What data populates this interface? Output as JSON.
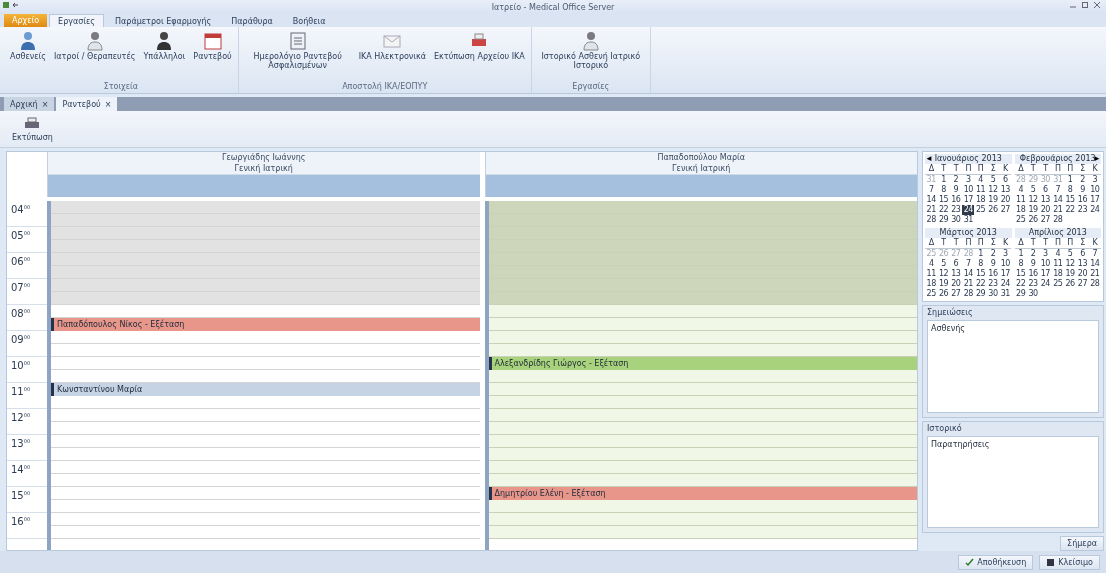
{
  "window": {
    "title": "Ιατρείο - Medical Office Server"
  },
  "ribbon": {
    "app_button": "Αρχείο",
    "tabs": [
      {
        "label": "Εργασίες",
        "selected": true
      },
      {
        "label": "Παράμετροι Εφαρμογής",
        "selected": false
      },
      {
        "label": "Παράθυρα",
        "selected": false
      },
      {
        "label": "Βοήθεια",
        "selected": false
      }
    ],
    "groups": [
      {
        "label": "Στοιχεία",
        "buttons": [
          {
            "label": "Ασθενείς",
            "kind": "patient"
          },
          {
            "label": "Ιατροί / Θεραπευτές",
            "kind": "doctor"
          },
          {
            "label": "Υπάλληλοι",
            "kind": "staff"
          },
          {
            "label": "Ραντεβού",
            "kind": "calendar"
          }
        ]
      },
      {
        "label": "Αποστολή ΙΚΑ/ΕΟΠΥΥ",
        "buttons": [
          {
            "label": "Ημερολόγιο Ραντεβού Ασφαλισμένων",
            "kind": "book"
          },
          {
            "label": "ΙΚΑ Ηλεκτρονικά",
            "kind": "mail"
          },
          {
            "label": "Εκτύπωση Αρχείου ΙΚΑ",
            "kind": "print"
          }
        ]
      },
      {
        "label": "Εργασίες",
        "buttons": [
          {
            "label": "Ιστορικό Ασθενή Ιατρικό Ιστορικό",
            "kind": "doctor"
          }
        ]
      }
    ]
  },
  "doc_tabs": [
    {
      "label": "Αρχική",
      "close": "×",
      "selected": false
    },
    {
      "label": "Ραντεβού",
      "close": "×",
      "selected": true
    }
  ],
  "toolbar": {
    "button": "Εκτύπωση"
  },
  "hours": [
    "04$^{00}$",
    "05$^{00}$",
    "06$^{00}$",
    "07$^{00}$",
    "08$^{00}$",
    "09$^{00}$",
    "10$^{00}$",
    "11$^{00}$",
    "12$^{00}$",
    "13$^{00}$",
    "14$^{00}$",
    "15$^{00}$",
    "16$^{00}$"
  ],
  "columns": [
    {
      "name": "Γεωργιάδης Ιωάννης",
      "specialty": "Γενική Ιατρική",
      "kind": "grey",
      "slots": [
        {
          "off": true
        },
        {
          "off": true
        },
        {
          "off": true
        },
        {
          "off": true
        },
        {
          "off": true
        },
        {
          "off": true
        },
        {
          "off": true
        },
        {
          "off": true
        },
        {
          "off": false
        },
        {
          "event": {
            "text": "Παπαδόπουλος Νίκος - Εξέταση",
            "color": "#e8968a"
          }
        },
        {
          "off": false
        },
        {
          "off": false
        },
        {
          "off": false
        },
        {
          "off": false
        },
        {
          "event": {
            "text": "Κωνσταντίνου Μαρία",
            "color": "#c6d3e4"
          }
        },
        {
          "off": false
        },
        {
          "off": false
        },
        {
          "off": false
        },
        {
          "off": false
        },
        {
          "off": false
        },
        {
          "off": false
        },
        {
          "off": false
        },
        {
          "off": false
        },
        {
          "off": false
        },
        {
          "off": false
        },
        {
          "off": false
        }
      ]
    },
    {
      "name": "Παπαδοπούλου Μαρία",
      "specialty": "Γενική Ιατρική",
      "kind": "green",
      "slots": [
        {
          "off": true
        },
        {
          "off": true
        },
        {
          "off": true
        },
        {
          "off": true
        },
        {
          "off": true
        },
        {
          "off": true
        },
        {
          "off": true
        },
        {
          "off": true
        },
        {
          "off": false
        },
        {
          "off": false
        },
        {
          "off": false
        },
        {
          "off": false
        },
        {
          "event": {
            "text": "Αλεξανδρίδης Γιώργος - Εξέταση",
            "color": "#a8d27c"
          }
        },
        {
          "off": false
        },
        {
          "off": false
        },
        {
          "off": false
        },
        {
          "off": false
        },
        {
          "off": false
        },
        {
          "off": false
        },
        {
          "off": false
        },
        {
          "off": false
        },
        {
          "off": false
        },
        {
          "event": {
            "text": "Δημητρίου Ελένη - Εξέταση",
            "color": "#e8968a"
          }
        },
        {
          "off": false
        },
        {
          "off": false
        },
        {
          "off": false
        }
      ]
    }
  ],
  "navigator": {
    "prev": "◄",
    "next": "►",
    "months": [
      {
        "title": "Ιανουάριος 2013",
        "weekdays": [
          "Δ",
          "Τ",
          "Τ",
          "Π",
          "Π",
          "Σ",
          "Κ"
        ],
        "lead": [
          "31"
        ],
        "days": [
          {
            "n": "1",
            "selected": false
          },
          {
            "n": "2",
            "selected": false
          },
          {
            "n": "3",
            "selected": false
          },
          {
            "n": "4",
            "selected": false
          },
          {
            "n": "5",
            "selected": false
          },
          {
            "n": "6",
            "selected": false
          },
          {
            "n": "7",
            "selected": false
          },
          {
            "n": "8",
            "selected": false
          },
          {
            "n": "9",
            "selected": false
          },
          {
            "n": "10",
            "selected": false
          },
          {
            "n": "11",
            "selected": false
          },
          {
            "n": "12",
            "selected": false
          },
          {
            "n": "13",
            "selected": false
          },
          {
            "n": "14",
            "selected": false
          },
          {
            "n": "15",
            "selected": false
          },
          {
            "n": "16",
            "selected": false
          },
          {
            "n": "17",
            "selected": false
          },
          {
            "n": "18",
            "selected": false
          },
          {
            "n": "19",
            "selected": false
          },
          {
            "n": "20",
            "selected": false
          },
          {
            "n": "21",
            "selected": false
          },
          {
            "n": "22",
            "selected": false
          },
          {
            "n": "23",
            "selected": false
          },
          {
            "n": "24",
            "selected": true
          },
          {
            "n": "25",
            "selected": false
          },
          {
            "n": "26",
            "selected": false
          },
          {
            "n": "27",
            "selected": false
          },
          {
            "n": "28",
            "selected": false
          },
          {
            "n": "29",
            "selected": false
          },
          {
            "n": "30",
            "selected": false
          },
          {
            "n": "31",
            "selected": false
          }
        ]
      },
      {
        "title": "Φεβρουάριος 2013",
        "weekdays": [
          "Δ",
          "Τ",
          "Τ",
          "Π",
          "Π",
          "Σ",
          "Κ"
        ],
        "lead": [
          "28",
          "29",
          "30",
          "31"
        ],
        "days": [
          {
            "n": "1",
            "selected": false
          },
          {
            "n": "2",
            "selected": false
          },
          {
            "n": "3",
            "selected": false
          },
          {
            "n": "4",
            "selected": false
          },
          {
            "n": "5",
            "selected": false
          },
          {
            "n": "6",
            "selected": false
          },
          {
            "n": "7",
            "selected": false
          },
          {
            "n": "8",
            "selected": false
          },
          {
            "n": "9",
            "selected": false
          },
          {
            "n": "10",
            "selected": false
          },
          {
            "n": "11",
            "selected": false
          },
          {
            "n": "12",
            "selected": false
          },
          {
            "n": "13",
            "selected": false
          },
          {
            "n": "14",
            "selected": false
          },
          {
            "n": "15",
            "selected": false
          },
          {
            "n": "16",
            "selected": false
          },
          {
            "n": "17",
            "selected": false
          },
          {
            "n": "18",
            "selected": false
          },
          {
            "n": "19",
            "selected": false
          },
          {
            "n": "20",
            "selected": false
          },
          {
            "n": "21",
            "selected": false
          },
          {
            "n": "22",
            "selected": false
          },
          {
            "n": "23",
            "selected": false
          },
          {
            "n": "24",
            "selected": false
          },
          {
            "n": "25",
            "selected": false
          },
          {
            "n": "26",
            "selected": false
          },
          {
            "n": "27",
            "selected": false
          },
          {
            "n": "28",
            "selected": false
          }
        ]
      },
      {
        "title": "Μάρτιος 2013",
        "weekdays": [
          "Δ",
          "Τ",
          "Τ",
          "Π",
          "Π",
          "Σ",
          "Κ"
        ],
        "lead": [
          "25",
          "26",
          "27",
          "28"
        ],
        "days": [
          {
            "n": "1",
            "selected": false
          },
          {
            "n": "2",
            "selected": false
          },
          {
            "n": "3",
            "selected": false
          },
          {
            "n": "4",
            "selected": false
          },
          {
            "n": "5",
            "selected": false
          },
          {
            "n": "6",
            "selected": false
          },
          {
            "n": "7",
            "selected": false
          },
          {
            "n": "8",
            "selected": false
          },
          {
            "n": "9",
            "selected": false
          },
          {
            "n": "10",
            "selected": false
          },
          {
            "n": "11",
            "selected": false
          },
          {
            "n": "12",
            "selected": false
          },
          {
            "n": "13",
            "selected": false
          },
          {
            "n": "14",
            "selected": false
          },
          {
            "n": "15",
            "selected": false
          },
          {
            "n": "16",
            "selected": false
          },
          {
            "n": "17",
            "selected": false
          },
          {
            "n": "18",
            "selected": false
          },
          {
            "n": "19",
            "selected": false
          },
          {
            "n": "20",
            "selected": false
          },
          {
            "n": "21",
            "selected": false
          },
          {
            "n": "22",
            "selected": false
          },
          {
            "n": "23",
            "selected": false
          },
          {
            "n": "24",
            "selected": false
          },
          {
            "n": "25",
            "selected": false
          },
          {
            "n": "26",
            "selected": false
          },
          {
            "n": "27",
            "selected": false
          },
          {
            "n": "28",
            "selected": false
          },
          {
            "n": "29",
            "selected": false
          },
          {
            "n": "30",
            "selected": false
          },
          {
            "n": "31",
            "selected": false
          }
        ]
      },
      {
        "title": "Απρίλιος 2013",
        "weekdays": [
          "Δ",
          "Τ",
          "Τ",
          "Π",
          "Π",
          "Σ",
          "Κ"
        ],
        "days": [
          {
            "n": "1",
            "selected": false
          },
          {
            "n": "2",
            "selected": false
          },
          {
            "n": "3",
            "selected": false
          },
          {
            "n": "4",
            "selected": false
          },
          {
            "n": "5",
            "selected": false
          },
          {
            "n": "6",
            "selected": false
          },
          {
            "n": "7",
            "selected": false
          },
          {
            "n": "8",
            "selected": false
          },
          {
            "n": "9",
            "selected": false
          },
          {
            "n": "10",
            "selected": false
          },
          {
            "n": "11",
            "selected": false
          },
          {
            "n": "12",
            "selected": false
          },
          {
            "n": "13",
            "selected": false
          },
          {
            "n": "14",
            "selected": false
          },
          {
            "n": "15",
            "selected": false
          },
          {
            "n": "16",
            "selected": false
          },
          {
            "n": "17",
            "selected": false
          },
          {
            "n": "18",
            "selected": false
          },
          {
            "n": "19",
            "selected": false
          },
          {
            "n": "20",
            "selected": false
          },
          {
            "n": "21",
            "selected": false
          },
          {
            "n": "22",
            "selected": false
          },
          {
            "n": "23",
            "selected": false
          },
          {
            "n": "24",
            "selected": false
          },
          {
            "n": "25",
            "selected": false
          },
          {
            "n": "26",
            "selected": false
          },
          {
            "n": "27",
            "selected": false
          },
          {
            "n": "28",
            "selected": false
          },
          {
            "n": "29",
            "selected": false
          },
          {
            "n": "30",
            "selected": false
          }
        ]
      }
    ]
  },
  "panels": [
    {
      "title": "Σημειώσεις",
      "value": "Ασθενής"
    },
    {
      "title": "Ιστορικό",
      "value": "Παρατηρήσεις"
    }
  ],
  "today_button": "Σήμερα",
  "status_buttons": [
    {
      "label": "Αποθήκευση",
      "kind": "save"
    },
    {
      "label": "Κλείσιμο",
      "kind": "close"
    }
  ]
}
